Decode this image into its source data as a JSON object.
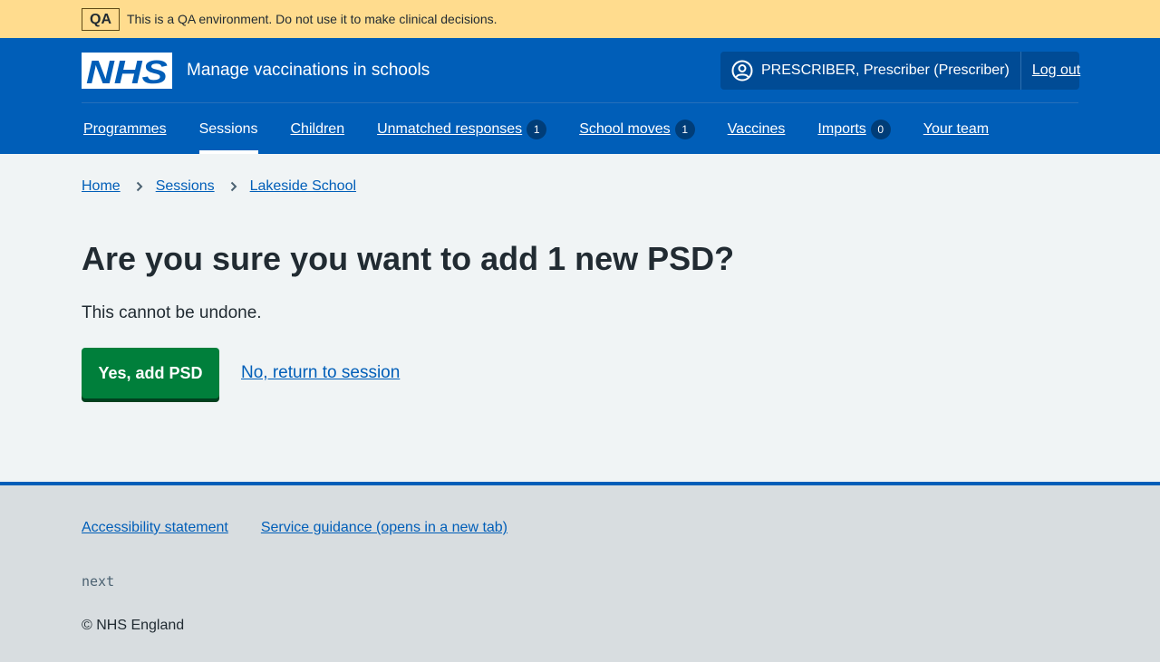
{
  "qa_banner": {
    "tag": "QA",
    "message": "This is a QA environment. Do not use it to make clinical decisions."
  },
  "header": {
    "logo_text": "NHS",
    "service_name": "Manage vaccinations in schools",
    "account": {
      "user_label": "PRESCRIBER, Prescriber (Prescriber)",
      "logout_label": "Log out"
    },
    "nav": [
      {
        "label": "Programmes",
        "badge": null
      },
      {
        "label": "Sessions",
        "badge": null,
        "active": true
      },
      {
        "label": "Children",
        "badge": null
      },
      {
        "label": "Unmatched responses",
        "badge": "1"
      },
      {
        "label": "School moves",
        "badge": "1"
      },
      {
        "label": "Vaccines",
        "badge": null
      },
      {
        "label": "Imports",
        "badge": "0"
      },
      {
        "label": "Your team",
        "badge": null
      }
    ]
  },
  "breadcrumb": [
    "Home",
    "Sessions",
    "Lakeside School"
  ],
  "main": {
    "title": "Are you sure you want to add 1 new PSD?",
    "lead": "This cannot be undone.",
    "confirm_label": "Yes, add PSD",
    "return_label": "No, return to session"
  },
  "footer": {
    "links": [
      "Accessibility statement",
      "Service guidance (opens in a new tab)"
    ],
    "version": "next",
    "copyright": "© NHS England"
  },
  "colors": {
    "brand_blue": "#005eb8",
    "qa_yellow": "#ffdc8e",
    "button_green": "#007f3b",
    "page_background": "#f0f4f5",
    "footer_background": "#d8dde0"
  }
}
